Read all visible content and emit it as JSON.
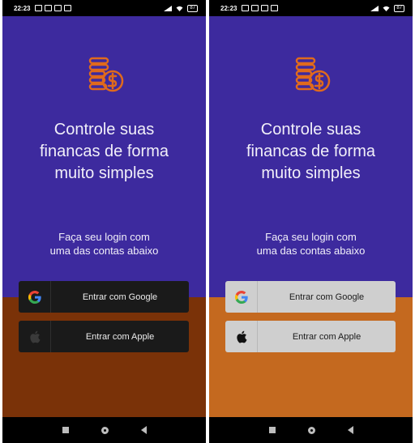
{
  "status_bar": {
    "time": "22:23",
    "battery": "87"
  },
  "headline": {
    "line1": "Controle suas",
    "line2": "financas de forma",
    "line3": "muito simples"
  },
  "subtext": {
    "line1": "Faça seu login com",
    "line2": "uma das contas abaixo"
  },
  "buttons": {
    "google_label": "Entrar com Google",
    "apple_label": "Entrar com Apple"
  },
  "icons": {
    "logo": "coins-dollar-icon",
    "google": "google-icon",
    "apple": "apple-icon",
    "nav_recent": "square-icon",
    "nav_home": "circle-icon",
    "nav_back": "back-triangle-icon"
  },
  "colors": {
    "top_background": "#3d2a9e",
    "accent_orange": "#e06a1c",
    "bottom_dark_theme": "#7a3208",
    "bottom_light_theme": "#c4691f",
    "button_dark": "#1a1a1a",
    "button_light": "#cfcfcf"
  },
  "variants": [
    "dark",
    "light"
  ]
}
